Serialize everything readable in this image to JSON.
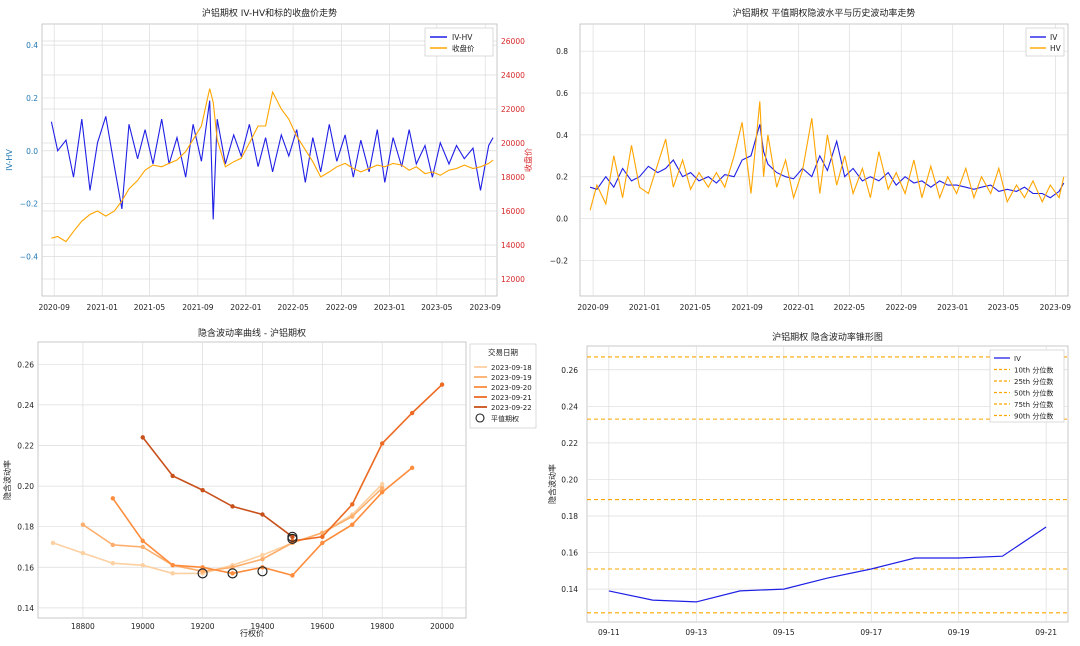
{
  "chart_data": [
    {
      "type": "line",
      "title": "沪铝期权 IV-HV和标的收盘价走势",
      "ylabel": "IV-HV",
      "y2label": "收盘价",
      "xlim": [
        "2020-08",
        "2023-10"
      ],
      "ylim": [
        -0.55,
        0.48
      ],
      "y2lim": [
        11000,
        27000
      ],
      "xticks": [
        "2020-09",
        "2021-01",
        "2021-05",
        "2021-09",
        "2022-01",
        "2022-05",
        "2022-09",
        "2023-01",
        "2023-05",
        "2023-09"
      ],
      "yticks": [
        "−0.4",
        "−0.2",
        "0.0",
        "0.2",
        "0.4"
      ],
      "y2ticks": [
        "12000",
        "14000",
        "16000",
        "18000",
        "20000",
        "22000",
        "24000",
        "26000"
      ],
      "legend": "top-right",
      "grid": true,
      "series": [
        {
          "name": "IV-HV",
          "color": "#1f1fe6",
          "axis": "left",
          "x": [
            "2020-08-25",
            "2020-09-10",
            "2020-10-01",
            "2020-10-20",
            "2020-11-10",
            "2020-12-01",
            "2020-12-20",
            "2021-01-10",
            "2021-02-01",
            "2021-02-20",
            "2021-03-10",
            "2021-04-01",
            "2021-04-20",
            "2021-05-10",
            "2021-06-01",
            "2021-06-20",
            "2021-07-10",
            "2021-08-01",
            "2021-08-20",
            "2021-09-10",
            "2021-10-01",
            "2021-10-10",
            "2021-10-20",
            "2021-11-10",
            "2021-12-01",
            "2021-12-20",
            "2022-01-10",
            "2022-02-01",
            "2022-02-20",
            "2022-03-10",
            "2022-04-01",
            "2022-04-20",
            "2022-05-10",
            "2022-06-01",
            "2022-06-20",
            "2022-07-10",
            "2022-08-01",
            "2022-08-20",
            "2022-09-10",
            "2022-10-01",
            "2022-10-20",
            "2022-11-10",
            "2022-12-01",
            "2022-12-20",
            "2023-01-10",
            "2023-02-01",
            "2023-02-20",
            "2023-03-10",
            "2023-04-01",
            "2023-04-20",
            "2023-05-10",
            "2023-06-01",
            "2023-06-20",
            "2023-07-10",
            "2023-08-01",
            "2023-08-20",
            "2023-09-10",
            "2023-09-21"
          ],
          "y": [
            0.11,
            0.0,
            0.04,
            -0.1,
            0.12,
            -0.15,
            0.03,
            0.13,
            -0.06,
            -0.22,
            0.1,
            -0.03,
            0.08,
            -0.05,
            0.12,
            -0.05,
            0.05,
            -0.1,
            0.1,
            -0.04,
            0.19,
            -0.26,
            0.12,
            -0.05,
            0.06,
            -0.02,
            0.1,
            -0.06,
            0.05,
            -0.08,
            0.06,
            -0.02,
            0.08,
            -0.12,
            0.05,
            -0.08,
            0.1,
            -0.04,
            0.06,
            -0.1,
            0.04,
            -0.08,
            0.08,
            -0.12,
            0.05,
            -0.06,
            0.08,
            -0.05,
            0.02,
            -0.1,
            0.03,
            -0.05,
            0.02,
            -0.03,
            0.01,
            -0.15,
            0.02,
            0.05
          ]
        },
        {
          "name": "收盘价",
          "color": "#ffa500",
          "axis": "right",
          "x": [
            "2020-08-25",
            "2020-09-10",
            "2020-10-01",
            "2020-10-20",
            "2020-11-10",
            "2020-12-01",
            "2020-12-20",
            "2021-01-10",
            "2021-02-01",
            "2021-02-20",
            "2021-03-10",
            "2021-04-01",
            "2021-04-20",
            "2021-05-10",
            "2021-06-01",
            "2021-06-20",
            "2021-07-10",
            "2021-08-01",
            "2021-08-20",
            "2021-09-10",
            "2021-10-01",
            "2021-10-10",
            "2021-10-20",
            "2021-11-10",
            "2021-12-01",
            "2021-12-20",
            "2022-01-10",
            "2022-02-01",
            "2022-02-20",
            "2022-03-10",
            "2022-04-01",
            "2022-04-20",
            "2022-05-10",
            "2022-06-01",
            "2022-06-20",
            "2022-07-10",
            "2022-08-01",
            "2022-08-20",
            "2022-09-10",
            "2022-10-01",
            "2022-10-20",
            "2022-11-10",
            "2022-12-01",
            "2022-12-20",
            "2023-01-10",
            "2023-02-01",
            "2023-02-20",
            "2023-03-10",
            "2023-04-01",
            "2023-04-20",
            "2023-05-10",
            "2023-06-01",
            "2023-06-20",
            "2023-07-10",
            "2023-08-01",
            "2023-08-20",
            "2023-09-10",
            "2023-09-21"
          ],
          "y": [
            14400,
            14500,
            14200,
            14800,
            15400,
            15800,
            16000,
            15700,
            16000,
            16600,
            17300,
            17800,
            18400,
            18700,
            18600,
            18800,
            19000,
            19500,
            20200,
            21000,
            23200,
            22400,
            20200,
            18600,
            18900,
            19100,
            20000,
            21000,
            21000,
            23000,
            22000,
            21400,
            20400,
            19600,
            18900,
            18000,
            18300,
            18600,
            18800,
            18500,
            18300,
            18500,
            18700,
            18600,
            18800,
            18700,
            18400,
            18600,
            18200,
            18300,
            18100,
            18400,
            18500,
            18700,
            18500,
            18600,
            18800,
            19000
          ]
        }
      ]
    },
    {
      "type": "line",
      "title": "沪铝期权 平值期权隐波水平与历史波动率走势",
      "xlim": [
        "2020-08",
        "2023-10"
      ],
      "ylim": [
        -0.37,
        0.93
      ],
      "xticks": [
        "2020-09",
        "2021-01",
        "2021-05",
        "2021-09",
        "2022-01",
        "2022-05",
        "2022-09",
        "2023-01",
        "2023-05",
        "2023-09"
      ],
      "yticks": [
        "−0.2",
        "0.0",
        "0.2",
        "0.4",
        "0.6",
        "0.8"
      ],
      "legend": "top-right",
      "grid": true,
      "series": [
        {
          "name": "IV",
          "color": "#1f1fe6",
          "x": [
            "2020-08-25",
            "2020-09-10",
            "2020-10-01",
            "2020-10-20",
            "2020-11-10",
            "2020-12-01",
            "2020-12-20",
            "2021-01-10",
            "2021-02-01",
            "2021-02-20",
            "2021-03-10",
            "2021-04-01",
            "2021-04-20",
            "2021-05-10",
            "2021-06-01",
            "2021-06-20",
            "2021-07-10",
            "2021-08-01",
            "2021-08-20",
            "2021-09-10",
            "2021-10-01",
            "2021-10-10",
            "2021-10-20",
            "2021-11-10",
            "2021-12-01",
            "2021-12-20",
            "2022-01-10",
            "2022-02-01",
            "2022-02-20",
            "2022-03-10",
            "2022-04-01",
            "2022-04-20",
            "2022-05-10",
            "2022-06-01",
            "2022-06-20",
            "2022-07-10",
            "2022-08-01",
            "2022-08-20",
            "2022-09-10",
            "2022-10-01",
            "2022-10-20",
            "2022-11-10",
            "2022-12-01",
            "2022-12-20",
            "2023-01-10",
            "2023-02-01",
            "2023-02-20",
            "2023-03-10",
            "2023-04-01",
            "2023-04-20",
            "2023-05-10",
            "2023-06-01",
            "2023-06-20",
            "2023-07-10",
            "2023-08-01",
            "2023-08-20",
            "2023-09-10",
            "2023-09-21"
          ],
          "y": [
            0.15,
            0.14,
            0.2,
            0.15,
            0.24,
            0.18,
            0.2,
            0.25,
            0.22,
            0.24,
            0.28,
            0.2,
            0.22,
            0.18,
            0.2,
            0.17,
            0.21,
            0.2,
            0.28,
            0.3,
            0.45,
            0.32,
            0.26,
            0.22,
            0.2,
            0.19,
            0.24,
            0.2,
            0.3,
            0.23,
            0.37,
            0.2,
            0.24,
            0.18,
            0.2,
            0.18,
            0.22,
            0.16,
            0.2,
            0.17,
            0.18,
            0.15,
            0.18,
            0.16,
            0.16,
            0.15,
            0.14,
            0.15,
            0.16,
            0.13,
            0.14,
            0.13,
            0.15,
            0.12,
            0.12,
            0.1,
            0.13,
            0.17
          ]
        },
        {
          "name": "HV",
          "color": "#ffa500",
          "x": [
            "2020-08-25",
            "2020-09-10",
            "2020-10-01",
            "2020-10-20",
            "2020-11-10",
            "2020-12-01",
            "2020-12-20",
            "2021-01-10",
            "2021-02-01",
            "2021-02-20",
            "2021-03-10",
            "2021-04-01",
            "2021-04-20",
            "2021-05-10",
            "2021-06-01",
            "2021-06-20",
            "2021-07-10",
            "2021-08-01",
            "2021-08-20",
            "2021-09-10",
            "2021-10-01",
            "2021-10-10",
            "2021-10-20",
            "2021-11-10",
            "2021-12-01",
            "2021-12-20",
            "2022-01-10",
            "2022-02-01",
            "2022-02-20",
            "2022-03-10",
            "2022-04-01",
            "2022-04-20",
            "2022-05-10",
            "2022-06-01",
            "2022-06-20",
            "2022-07-10",
            "2022-08-01",
            "2022-08-20",
            "2022-09-10",
            "2022-10-01",
            "2022-10-20",
            "2022-11-10",
            "2022-12-01",
            "2022-12-20",
            "2023-01-10",
            "2023-02-01",
            "2023-02-20",
            "2023-03-10",
            "2023-04-01",
            "2023-04-20",
            "2023-05-10",
            "2023-06-01",
            "2023-06-20",
            "2023-07-10",
            "2023-08-01",
            "2023-08-20",
            "2023-09-10",
            "2023-09-21"
          ],
          "y": [
            0.04,
            0.16,
            0.07,
            0.3,
            0.1,
            0.35,
            0.15,
            0.12,
            0.26,
            0.38,
            0.15,
            0.28,
            0.14,
            0.22,
            0.15,
            0.22,
            0.15,
            0.3,
            0.46,
            0.12,
            0.56,
            0.2,
            0.4,
            0.15,
            0.28,
            0.1,
            0.23,
            0.48,
            0.12,
            0.4,
            0.16,
            0.3,
            0.12,
            0.24,
            0.1,
            0.32,
            0.14,
            0.22,
            0.12,
            0.28,
            0.1,
            0.25,
            0.1,
            0.2,
            0.12,
            0.24,
            0.1,
            0.2,
            0.12,
            0.24,
            0.08,
            0.16,
            0.1,
            0.18,
            0.08,
            0.16,
            0.1,
            0.2
          ]
        }
      ]
    },
    {
      "type": "line",
      "title": "隐含波动率曲线 - 沪铝期权",
      "xlabel": "行权价",
      "ylabel": "隐含波动率",
      "xlim": [
        18650,
        20080
      ],
      "ylim": [
        0.135,
        0.271
      ],
      "xticks": [
        "18800",
        "19000",
        "19200",
        "19400",
        "19600",
        "19800",
        "20000"
      ],
      "yticks": [
        "0.14",
        "0.16",
        "0.18",
        "0.20",
        "0.22",
        "0.24",
        "0.26"
      ],
      "legend_title": "交易日期",
      "legend": "top-right outside",
      "grid": true,
      "atm_label": "平值期权",
      "series": [
        {
          "name": "2023-09-18",
          "color": "#fdd0a2",
          "x": [
            18700,
            18800,
            18900,
            19000,
            19100,
            19200,
            19300,
            19400,
            19500,
            19600,
            19700,
            19800
          ],
          "y": [
            0.172,
            0.167,
            0.162,
            0.161,
            0.157,
            0.157,
            0.161,
            0.166,
            0.172,
            0.177,
            0.186,
            0.201
          ],
          "atm": [
            19300,
            0.157
          ]
        },
        {
          "name": "2023-09-19",
          "color": "#fdae6b",
          "x": [
            18800,
            18900,
            19000,
            19100,
            19200,
            19300,
            19400,
            19500,
            19600,
            19700,
            19800
          ],
          "y": [
            0.181,
            0.171,
            0.17,
            0.161,
            0.158,
            0.16,
            0.164,
            0.172,
            0.177,
            0.185,
            0.199
          ],
          "atm": [
            19200,
            0.157
          ]
        },
        {
          "name": "2023-09-20",
          "color": "#fd8d3c",
          "x": [
            18900,
            19000,
            19100,
            19200,
            19300,
            19400,
            19500,
            19600,
            19700,
            19800,
            19900
          ],
          "y": [
            0.194,
            0.173,
            0.161,
            0.16,
            0.157,
            0.16,
            0.156,
            0.172,
            0.181,
            0.197,
            0.209
          ],
          "atm": [
            19400,
            0.158
          ]
        },
        {
          "name": "2023-09-21",
          "color": "#ec6a22",
          "x": [
            19500,
            19600,
            19700,
            19800,
            19900,
            20000
          ],
          "y": [
            0.173,
            0.175,
            0.191,
            0.221,
            0.236,
            0.25
          ],
          "atm": [
            19500,
            0.174
          ]
        },
        {
          "name": "2023-09-22",
          "color": "#c8501a",
          "x": [
            19000,
            19100,
            19200,
            19300,
            19400,
            19500
          ],
          "y": [
            0.224,
            0.205,
            0.198,
            0.19,
            0.186,
            0.175
          ],
          "atm": [
            19500,
            0.175
          ]
        }
      ]
    },
    {
      "type": "line",
      "title": "沪铝期权 隐含波动率锥形图",
      "ylabel": "隐含波动率",
      "ylim": [
        0.122,
        0.273
      ],
      "categories": [
        "09-11",
        "09-12",
        "09-13",
        "09-14",
        "09-15",
        "09-16",
        "09-17",
        "09-18",
        "09-19",
        "09-20",
        "09-21"
      ],
      "xticks": [
        "09-11",
        "09-13",
        "09-15",
        "09-17",
        "09-19",
        "09-21"
      ],
      "yticks": [
        "0.14",
        "0.16",
        "0.18",
        "0.20",
        "0.22",
        "0.24",
        "0.26"
      ],
      "legend": "top-right",
      "grid": true,
      "series": [
        {
          "name": "IV",
          "color": "#1f1fe6",
          "values": [
            0.139,
            0.134,
            0.133,
            0.139,
            0.14,
            0.146,
            0.151,
            0.157,
            0.157,
            0.158,
            0.174
          ]
        }
      ],
      "percentiles": [
        {
          "name": "10th 分位数",
          "value": 0.127,
          "color": "#ffa500"
        },
        {
          "name": "25th 分位数",
          "value": 0.151,
          "color": "#ffa500"
        },
        {
          "name": "50th 分位数",
          "value": 0.189,
          "color": "#ffa500"
        },
        {
          "name": "75th 分位数",
          "value": 0.233,
          "color": "#ffa500"
        },
        {
          "name": "90th 分位数",
          "value": 0.267,
          "color": "#ffa500"
        }
      ]
    }
  ]
}
